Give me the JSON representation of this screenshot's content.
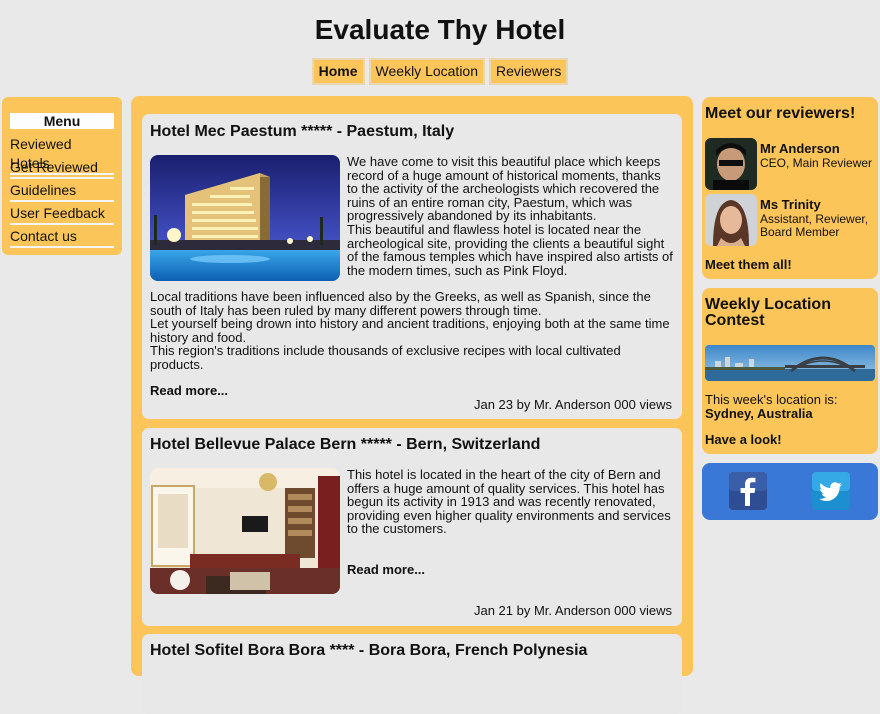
{
  "site": {
    "title": "Evaluate Thy Hotel"
  },
  "nav": [
    {
      "label": "Home"
    },
    {
      "label": "Weekly Location"
    },
    {
      "label": "Reviewers"
    }
  ],
  "menu": {
    "title": "Menu",
    "items": [
      {
        "label": "Reviewed Hotels"
      },
      {
        "label": "Get Reviewed"
      },
      {
        "label": "Guidelines"
      },
      {
        "label": "User Feedback"
      },
      {
        "label": "Contact us"
      }
    ]
  },
  "articles": [
    {
      "title": "Hotel Mec Paestum ***** - Paestum, Italy",
      "paragraphs": [
        "We have come to visit this beautiful place which keeps record of a huge amount of historical moments, thanks to the activity of the archeologists which recovered the ruins of an entire roman city, Paestum, which was progressively abandoned by its inhabitants.",
        "This beautiful and flawless hotel is located near the archeological site, providing the clients a beautiful sight of the famous temples which have inspired also artists of the modern times, such as Pink Floyd.",
        "Local traditions have been influenced also by the Greeks, as well as Spanish, since the south of Italy has been ruled by many different powers through time.",
        "Let yourself being drown into history and ancient traditions, enjoying both at the same time history and food.",
        "This region's traditions include thousands of exclusive recipes with local cultivated products."
      ],
      "read_more": "Read more...",
      "meta": "Jan 23 by Mr. Anderson 000 views"
    },
    {
      "title": "Hotel Bellevue Palace Bern ***** - Bern, Switzerland",
      "paragraphs": [
        "This hotel is located in the heart of the city of Bern and offers a huge amount of quality services. This hotel has begun its activity in 1913 and was recently renovated, providing even higher quality environments and services to the customers."
      ],
      "read_more": "Read more...",
      "meta": "Jan 21 by Mr. Anderson 000 views"
    },
    {
      "title": "Hotel Sofitel Bora Bora **** - Bora Bora, French Polynesia"
    }
  ],
  "reviewers_box": {
    "title": "Meet our reviewers!",
    "reviewers": [
      {
        "name": "Mr Anderson",
        "role": "CEO, Main Reviewer"
      },
      {
        "name": "Ms Trinity",
        "role": "Assistant, Reviewer, Board Member"
      }
    ],
    "link": "Meet them all!"
  },
  "contest_box": {
    "title": "Weekly Location Contest",
    "text": "This week's location is:",
    "location": "Sydney, Australia",
    "link": "Have a look!"
  },
  "social": {
    "facebook_icon": "facebook-icon",
    "twitter_icon": "twitter-icon"
  },
  "colors": {
    "accent": "#fbc55a",
    "card": "#e8e8e8",
    "social": "#3a78d8",
    "page": "#e9e9e9"
  }
}
